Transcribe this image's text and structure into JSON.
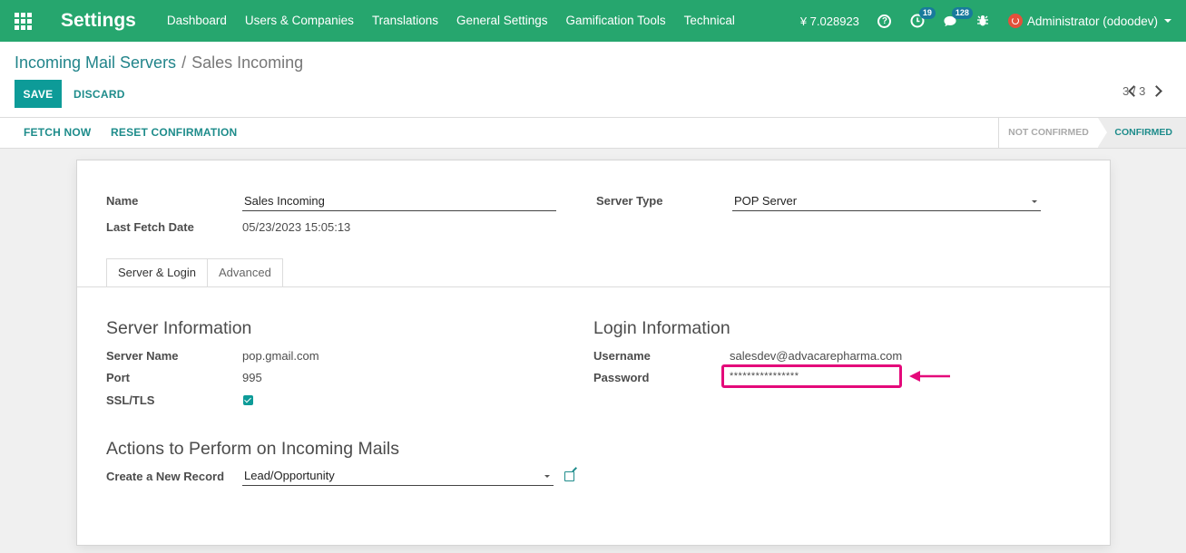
{
  "navbar": {
    "title": "Settings",
    "menu": [
      "Dashboard",
      "Users & Companies",
      "Translations",
      "General Settings",
      "Gamification Tools",
      "Technical"
    ],
    "amount": "¥ 7.028923",
    "activity_count": "19",
    "messages_count": "128",
    "user": "Administrator (odoodev)"
  },
  "breadcrumb": {
    "parent": "Incoming Mail Servers",
    "separator": "/",
    "current": "Sales Incoming"
  },
  "buttons": {
    "save": "SAVE",
    "discard": "DISCARD",
    "fetch_now": "FETCH NOW",
    "reset_confirmation": "RESET CONFIRMATION"
  },
  "pager": {
    "value": "3 / 3"
  },
  "status": {
    "stages": [
      "NOT CONFIRMED",
      "CONFIRMED"
    ],
    "active": "CONFIRMED"
  },
  "form": {
    "name_label": "Name",
    "name_value": "Sales Incoming",
    "last_fetch_label": "Last Fetch Date",
    "last_fetch_value": "05/23/2023 15:05:13",
    "server_type_label": "Server Type",
    "server_type_value": "POP Server",
    "tabs": [
      "Server & Login",
      "Advanced"
    ],
    "server_info_title": "Server Information",
    "server_name_label": "Server Name",
    "server_name_value": "pop.gmail.com",
    "port_label": "Port",
    "port_value": "995",
    "ssl_label": "SSL/TLS",
    "ssl_checked": true,
    "login_info_title": "Login Information",
    "username_label": "Username",
    "username_value": "salesdev@advacarepharma.com",
    "password_label": "Password",
    "password_value": "****************",
    "actions_title": "Actions to Perform on Incoming Mails",
    "create_record_label": "Create a New Record",
    "create_record_value": "Lead/Opportunity"
  },
  "colors": {
    "navbar": "#26a66e",
    "primary": "#0d9b98",
    "highlight": "#e4097a"
  }
}
